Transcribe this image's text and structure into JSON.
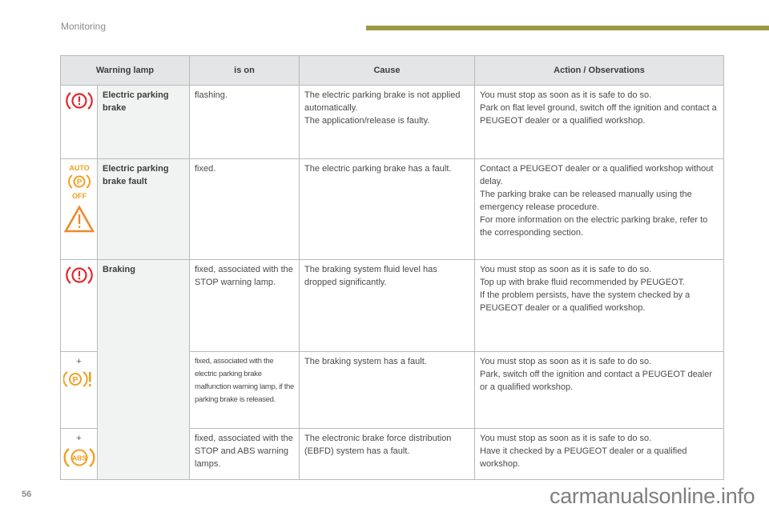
{
  "header": {
    "section_title": "Monitoring",
    "accent_color": "#9c9a45"
  },
  "table": {
    "columns": [
      "Warning lamp",
      "is on",
      "Cause",
      "Action / Observations"
    ],
    "rows": [
      {
        "icons": [
          "brake-warning-icon"
        ],
        "icon_color": "#e0282e",
        "prefix": "",
        "name": "Electric parking brake",
        "is_on": "flashing.",
        "cause": [
          "The electric parking brake is not applied automatically.",
          "The application/release is faulty."
        ],
        "action": [
          "You must stop as soon as it is safe to do so.",
          "Park on flat level ground, switch off the ignition and contact a PEUGEOT dealer or a qualified workshop."
        ]
      },
      {
        "icons": [
          "auto-p-off-icon",
          "warning-triangle-icon"
        ],
        "icon_color": "#f0a020",
        "icon_text": {
          "auto": "AUTO",
          "p": "P",
          "off": "OFF"
        },
        "prefix": "",
        "name": "Electric parking brake fault",
        "is_on": "fixed.",
        "cause": [
          "The electric parking brake has a fault."
        ],
        "action": [
          "Contact a PEUGEOT dealer or a qualified workshop without delay.",
          "The parking brake can be released manually using the emergency release procedure.",
          "For more information on the electric parking brake, refer to the corresponding section."
        ]
      },
      {
        "icons": [
          "brake-warning-icon"
        ],
        "icon_color": "#e0282e",
        "prefix": "",
        "name": "Braking",
        "is_on": "fixed, associated with the STOP warning lamp.",
        "cause": [
          "The braking system fluid level has dropped significantly."
        ],
        "action": [
          "You must stop as soon as it is safe to do so.",
          "Top up with brake fluid recommended by PEUGEOT.",
          "If the problem persists, have the system checked by a PEUGEOT dealer or a qualified workshop."
        ]
      },
      {
        "icons": [
          "parking-brake-fault-icon"
        ],
        "icon_color": "#f0a020",
        "icon_text": {
          "p": "P"
        },
        "prefix": "+",
        "name": "",
        "is_on": "fixed, associated with the electric parking brake malfunction warning lamp, if the parking brake is released.",
        "cause": [
          "The braking system has a fault."
        ],
        "action": [
          "You must stop as soon as it is safe to do so.",
          "Park, switch off the ignition and contact a PEUGEOT dealer or a qualified workshop."
        ]
      },
      {
        "icons": [
          "abs-icon"
        ],
        "icon_color": "#f0a020",
        "icon_text": {
          "abs": "ABS"
        },
        "prefix": "+",
        "name": "",
        "is_on": "fixed, associated with the STOP and ABS warning lamps.",
        "cause": [
          "The electronic brake force distribution (EBFD) system has a fault."
        ],
        "action": [
          "You must stop as soon as it is safe to do so.",
          "Have it checked by a PEUGEOT dealer or a qualified workshop."
        ]
      }
    ]
  },
  "footer": {
    "page_number": "56",
    "watermark": "carmanualsonline.info"
  }
}
